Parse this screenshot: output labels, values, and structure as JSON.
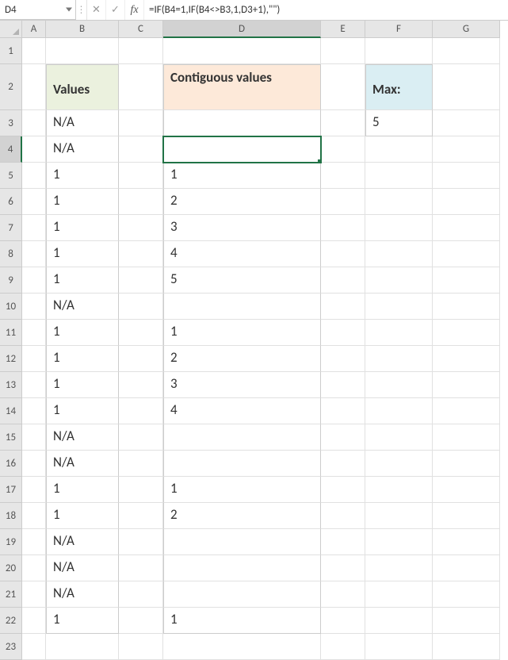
{
  "nameBox": "D4",
  "formula": "=IF(B4=1,IF(B4<>B3,1,D3+1),\"\")",
  "fbIcons": {
    "cancel": "✕",
    "confirm": "✓",
    "fx": "fx",
    "vdots": "⋮"
  },
  "columns": [
    "A",
    "B",
    "C",
    "D",
    "E",
    "F",
    "G"
  ],
  "rowLabels": [
    "1",
    "2",
    "3",
    "4",
    "5",
    "6",
    "7",
    "8",
    "9",
    "10",
    "11",
    "12",
    "13",
    "14",
    "15",
    "16",
    "17",
    "18",
    "19",
    "20",
    "21",
    "22",
    "23"
  ],
  "activeCol": "D",
  "activeRow": "4",
  "headers": {
    "values": "Values",
    "contiguous": "Contiguous values",
    "max": "Max:"
  },
  "maxValue": "5",
  "data": {
    "B": {
      "3": "N/A",
      "4": "N/A",
      "5": "1",
      "6": "1",
      "7": "1",
      "8": "1",
      "9": "1",
      "10": "N/A",
      "11": "1",
      "12": "1",
      "13": "1",
      "14": "1",
      "15": "N/A",
      "16": "N/A",
      "17": "1",
      "18": "1",
      "19": "N/A",
      "20": "N/A",
      "21": "N/A",
      "22": "1"
    },
    "D": {
      "3": "",
      "4": "",
      "5": "1",
      "6": "2",
      "7": "3",
      "8": "4",
      "9": "5",
      "10": "",
      "11": "1",
      "12": "2",
      "13": "3",
      "14": "4",
      "15": "",
      "16": "",
      "17": "1",
      "18": "2",
      "19": "",
      "20": "",
      "21": "",
      "22": "1"
    }
  },
  "chart_data": {
    "type": "table",
    "title": "Contiguous run counter",
    "columns": [
      "Values",
      "Contiguous values"
    ],
    "rows": [
      [
        "N/A",
        ""
      ],
      [
        "N/A",
        ""
      ],
      [
        "1",
        "1"
      ],
      [
        "1",
        "2"
      ],
      [
        "1",
        "3"
      ],
      [
        "1",
        "4"
      ],
      [
        "1",
        "5"
      ],
      [
        "N/A",
        ""
      ],
      [
        "1",
        "1"
      ],
      [
        "1",
        "2"
      ],
      [
        "1",
        "3"
      ],
      [
        "1",
        "4"
      ],
      [
        "N/A",
        ""
      ],
      [
        "N/A",
        ""
      ],
      [
        "1",
        "1"
      ],
      [
        "1",
        "2"
      ],
      [
        "N/A",
        ""
      ],
      [
        "N/A",
        ""
      ],
      [
        "N/A",
        ""
      ],
      [
        "1",
        "1"
      ]
    ],
    "summary": {
      "Max": 5
    }
  }
}
